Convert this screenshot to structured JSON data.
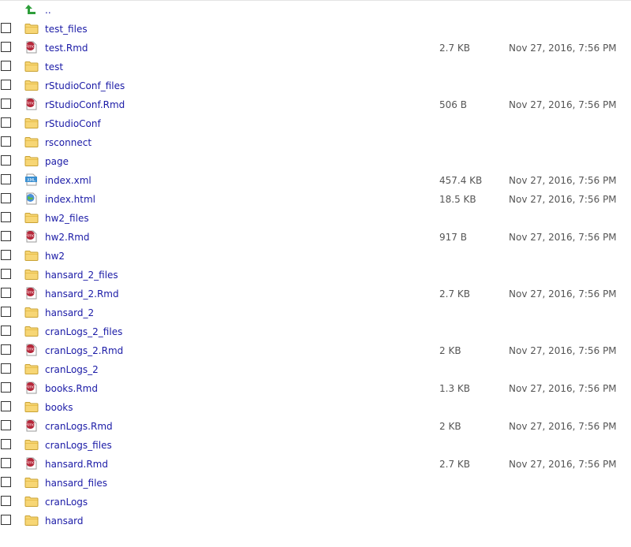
{
  "parent_label": "..",
  "files": [
    {
      "name": "test_files",
      "type": "folder",
      "size": "",
      "modified": ""
    },
    {
      "name": "test.Rmd",
      "type": "rmd",
      "size": "2.7 KB",
      "modified": "Nov 27, 2016, 7:56 PM"
    },
    {
      "name": "test",
      "type": "folder",
      "size": "",
      "modified": ""
    },
    {
      "name": "rStudioConf_files",
      "type": "folder",
      "size": "",
      "modified": ""
    },
    {
      "name": "rStudioConf.Rmd",
      "type": "rmd",
      "size": "506 B",
      "modified": "Nov 27, 2016, 7:56 PM"
    },
    {
      "name": "rStudioConf",
      "type": "folder",
      "size": "",
      "modified": ""
    },
    {
      "name": "rsconnect",
      "type": "folder",
      "size": "",
      "modified": ""
    },
    {
      "name": "page",
      "type": "folder",
      "size": "",
      "modified": ""
    },
    {
      "name": "index.xml",
      "type": "xml",
      "size": "457.4 KB",
      "modified": "Nov 27, 2016, 7:56 PM"
    },
    {
      "name": "index.html",
      "type": "html",
      "size": "18.5 KB",
      "modified": "Nov 27, 2016, 7:56 PM"
    },
    {
      "name": "hw2_files",
      "type": "folder",
      "size": "",
      "modified": ""
    },
    {
      "name": "hw2.Rmd",
      "type": "rmd",
      "size": "917 B",
      "modified": "Nov 27, 2016, 7:56 PM"
    },
    {
      "name": "hw2",
      "type": "folder",
      "size": "",
      "modified": ""
    },
    {
      "name": "hansard_2_files",
      "type": "folder",
      "size": "",
      "modified": ""
    },
    {
      "name": "hansard_2.Rmd",
      "type": "rmd",
      "size": "2.7 KB",
      "modified": "Nov 27, 2016, 7:56 PM"
    },
    {
      "name": "hansard_2",
      "type": "folder",
      "size": "",
      "modified": ""
    },
    {
      "name": "cranLogs_2_files",
      "type": "folder",
      "size": "",
      "modified": ""
    },
    {
      "name": "cranLogs_2.Rmd",
      "type": "rmd",
      "size": "2 KB",
      "modified": "Nov 27, 2016, 7:56 PM"
    },
    {
      "name": "cranLogs_2",
      "type": "folder",
      "size": "",
      "modified": ""
    },
    {
      "name": "books.Rmd",
      "type": "rmd",
      "size": "1.3 KB",
      "modified": "Nov 27, 2016, 7:56 PM"
    },
    {
      "name": "books",
      "type": "folder",
      "size": "",
      "modified": ""
    },
    {
      "name": "cranLogs.Rmd",
      "type": "rmd",
      "size": "2 KB",
      "modified": "Nov 27, 2016, 7:56 PM"
    },
    {
      "name": "cranLogs_files",
      "type": "folder",
      "size": "",
      "modified": ""
    },
    {
      "name": "hansard.Rmd",
      "type": "rmd",
      "size": "2.7 KB",
      "modified": "Nov 27, 2016, 7:56 PM"
    },
    {
      "name": "hansard_files",
      "type": "folder",
      "size": "",
      "modified": ""
    },
    {
      "name": "cranLogs",
      "type": "folder",
      "size": "",
      "modified": ""
    },
    {
      "name": "hansard",
      "type": "folder",
      "size": "",
      "modified": ""
    }
  ],
  "colors": {
    "link": "#1a1aa6",
    "meta_text": "#555555",
    "folder_fill": "#f7d675",
    "folder_stroke": "#c9a233",
    "rmd_badge": "#b5283a",
    "up_arrow": "#2e9e3a"
  },
  "icons": {
    "up": "parent-directory-icon",
    "folder": "folder-icon",
    "rmd": "rmarkdown-file-icon",
    "xml": "xml-file-icon",
    "html": "html-file-icon"
  }
}
